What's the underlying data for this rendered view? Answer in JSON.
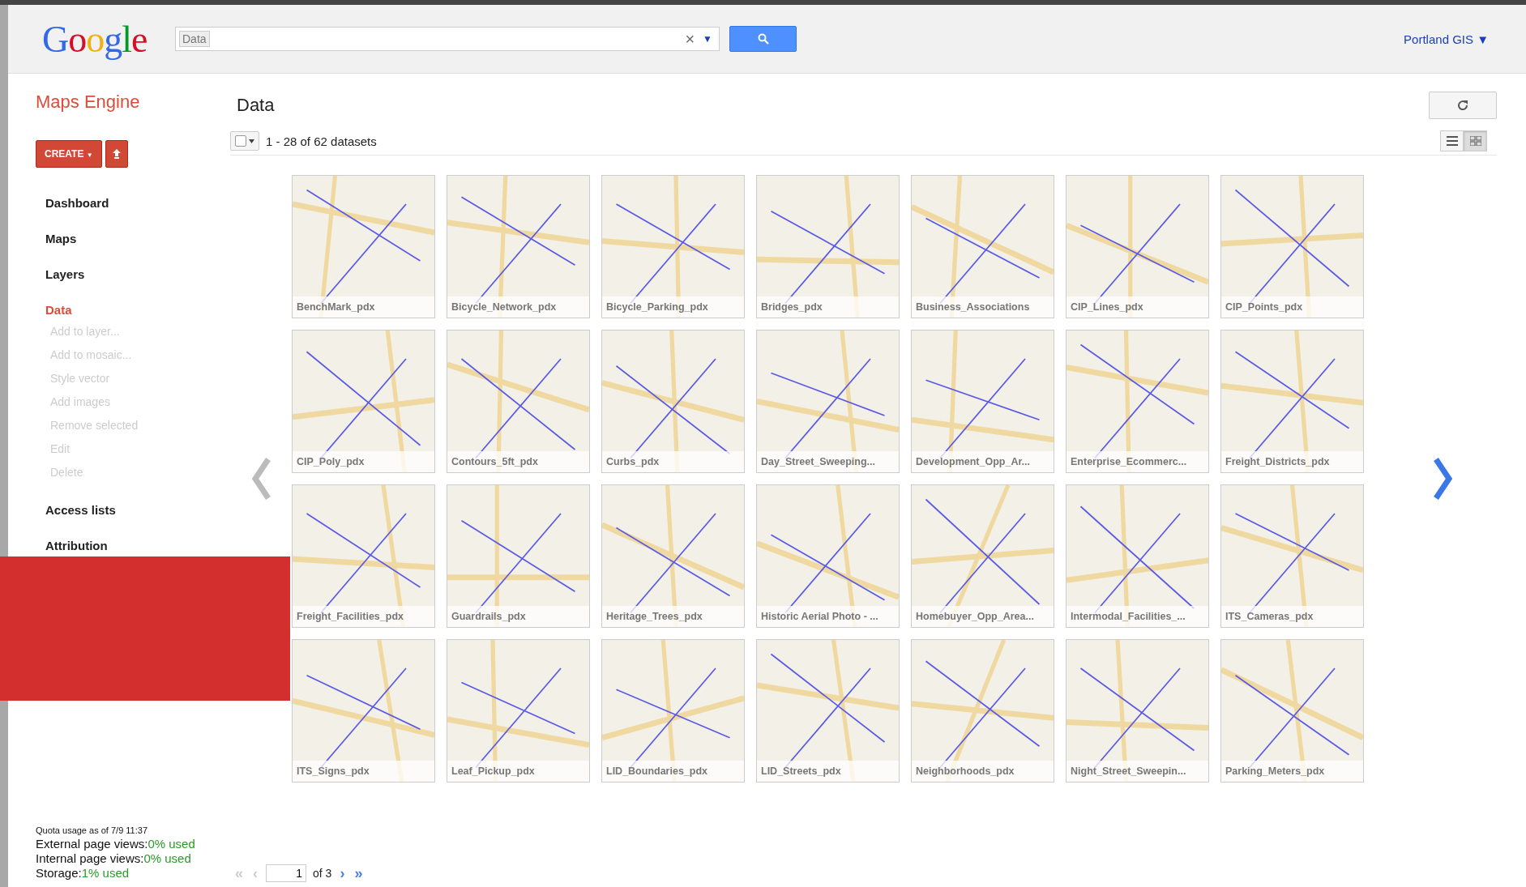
{
  "header": {
    "logo": "Google",
    "search": {
      "value": "Data",
      "clear": "×",
      "dropdown": "▼"
    },
    "account": "Portland GIS",
    "account_caret": "▼"
  },
  "app_title": "Maps Engine",
  "create_button": {
    "label": "CREATE",
    "caret": "▼"
  },
  "sidebar": {
    "items": [
      {
        "label": "Dashboard",
        "kind": "main",
        "selected": false,
        "disabled": false
      },
      {
        "label": "Maps",
        "kind": "main",
        "selected": false,
        "disabled": false
      },
      {
        "label": "Layers",
        "kind": "main",
        "selected": false,
        "disabled": false
      },
      {
        "label": "Data",
        "kind": "main",
        "selected": true,
        "disabled": false
      },
      {
        "label": "Add to layer...",
        "kind": "sub",
        "selected": false,
        "disabled": true
      },
      {
        "label": "Add to mosaic...",
        "kind": "sub",
        "selected": false,
        "disabled": true
      },
      {
        "label": "Style vector",
        "kind": "sub",
        "selected": false,
        "disabled": true
      },
      {
        "label": "Add images",
        "kind": "sub",
        "selected": false,
        "disabled": true
      },
      {
        "label": "Remove selected",
        "kind": "sub",
        "selected": false,
        "disabled": true
      },
      {
        "label": "Edit",
        "kind": "sub",
        "selected": false,
        "disabled": true
      },
      {
        "label": "Delete",
        "kind": "sub",
        "selected": false,
        "disabled": true
      },
      {
        "label": "Access lists",
        "kind": "main",
        "selected": false,
        "disabled": false
      },
      {
        "label": "Attribution",
        "kind": "main",
        "selected": false,
        "disabled": false
      }
    ]
  },
  "quota": {
    "title": "Quota usage as of 7/9 11:37",
    "lines": [
      {
        "label": "External page views:",
        "value": "0% used"
      },
      {
        "label": "Internal page views:",
        "value": "0% used"
      },
      {
        "label": "Storage:",
        "value": "1% used"
      }
    ]
  },
  "page_title": "Data",
  "toolbar": {
    "select_all_checked": false,
    "count": "1 - 28 of 62 datasets",
    "views": [
      {
        "kind": "list",
        "selected": false
      },
      {
        "kind": "grid",
        "selected": true
      }
    ]
  },
  "datasets": [
    {
      "label": "BenchMark_pdx"
    },
    {
      "label": "Bicycle_Network_pdx"
    },
    {
      "label": "Bicycle_Parking_pdx"
    },
    {
      "label": "Bridges_pdx"
    },
    {
      "label": "Business_Associations"
    },
    {
      "label": "CIP_Lines_pdx"
    },
    {
      "label": "CIP_Points_pdx"
    },
    {
      "label": "CIP_Poly_pdx"
    },
    {
      "label": "Contours_5ft_pdx"
    },
    {
      "label": "Curbs_pdx"
    },
    {
      "label": "Day_Street_Sweeping..."
    },
    {
      "label": "Development_Opp_Ar..."
    },
    {
      "label": "Enterprise_Ecommerc..."
    },
    {
      "label": "Freight_Districts_pdx"
    },
    {
      "label": "Freight_Facilities_pdx"
    },
    {
      "label": "Guardrails_pdx"
    },
    {
      "label": "Heritage_Trees_pdx"
    },
    {
      "label": "Historic Aerial Photo - ..."
    },
    {
      "label": "Homebuyer_Opp_Area..."
    },
    {
      "label": "Intermodal_Facilities_..."
    },
    {
      "label": "ITS_Cameras_pdx"
    },
    {
      "label": "ITS_Signs_pdx"
    },
    {
      "label": "Leaf_Pickup_pdx"
    },
    {
      "label": "LID_Boundaries_pdx"
    },
    {
      "label": "LID_Streets_pdx"
    },
    {
      "label": "Neighborhoods_pdx"
    },
    {
      "label": "Night_Street_Sweepin..."
    },
    {
      "label": "Parking_Meters_pdx"
    }
  ],
  "pagination": {
    "first": "«",
    "prev": "‹",
    "page": "1",
    "of": "of 3",
    "next": "›",
    "last": "»"
  }
}
